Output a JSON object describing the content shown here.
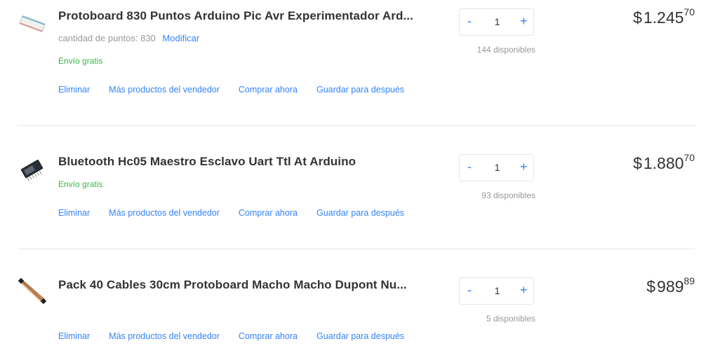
{
  "items": [
    {
      "title": "Protoboard 830 Puntos Arduino Pic Avr Experimentador Ard...",
      "variant_text": "cantidad de puntos: 830",
      "variant_modify": "Modificar",
      "shipping": "Envío gratis",
      "actions": [
        "Eliminar",
        "Más productos del vendedor",
        "Comprar ahora",
        "Guardar para después"
      ],
      "qty_minus": "-",
      "qty_value": "1",
      "qty_plus": "+",
      "stock": "144 disponibles",
      "price_currency": "$",
      "price_int": "1.245",
      "price_cents": "70"
    },
    {
      "title": "Bluetooth Hc05 Maestro Esclavo Uart Ttl At Arduino",
      "shipping": "Envío gratis",
      "actions": [
        "Eliminar",
        "Más productos del vendedor",
        "Comprar ahora",
        "Guardar para después"
      ],
      "qty_minus": "-",
      "qty_value": "1",
      "qty_plus": "+",
      "stock": "93 disponibles",
      "price_currency": "$",
      "price_int": "1.880",
      "price_cents": "70"
    },
    {
      "title": "Pack 40 Cables 30cm Protoboard Macho Macho Dupont Nu...",
      "actions": [
        "Eliminar",
        "Más productos del vendedor",
        "Comprar ahora",
        "Guardar para después"
      ],
      "qty_minus": "-",
      "qty_value": "1",
      "qty_plus": "+",
      "stock": "5 disponibles",
      "price_currency": "$",
      "price_int": "989",
      "price_cents": "89"
    }
  ],
  "colors": {
    "link": "#3483fa",
    "free_shipping": "#39b54a",
    "muted": "#999999",
    "text": "#333333",
    "divider": "#e6e6e6"
  },
  "icons": [
    "protoboard-thumbnail",
    "bluetooth-module-thumbnail",
    "dupont-cables-thumbnail"
  ]
}
